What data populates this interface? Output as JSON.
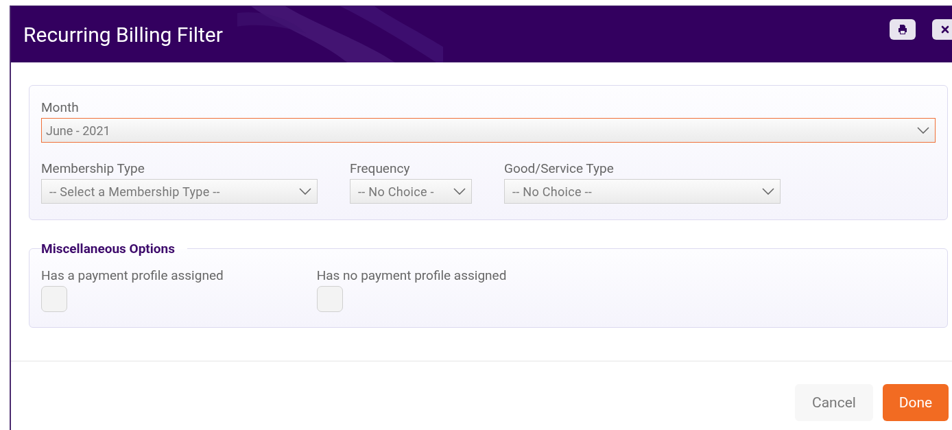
{
  "dialog": {
    "title": "Recurring Billing Filter"
  },
  "filters": [
    {
      "label": "Month",
      "value": "June - 2021",
      "focused": true,
      "kind": "full"
    },
    {
      "label": "Membership Type",
      "value": "-- Select a Membership Type --",
      "focused": false,
      "kind": "wide"
    },
    {
      "label": "Frequency",
      "value": "-- No Choice -",
      "focused": false,
      "kind": "narrow"
    },
    {
      "label": "Good/Service Type",
      "value": "-- No Choice --",
      "focused": false,
      "kind": "wide"
    }
  ],
  "misc": {
    "legend": "Miscellaneous Options",
    "options": [
      {
        "label": "Has a payment profile assigned",
        "checked": false
      },
      {
        "label": "Has no payment profile assigned",
        "checked": false
      }
    ]
  },
  "buttons": [
    {
      "label": "Cancel",
      "kind": "secondary"
    },
    {
      "label": "Done",
      "kind": "primary"
    }
  ]
}
